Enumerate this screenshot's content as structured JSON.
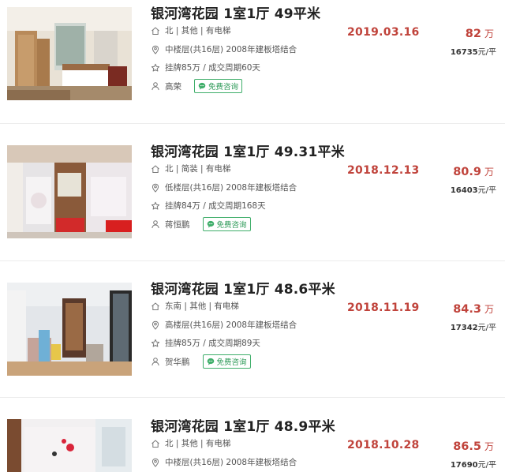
{
  "listings": [
    {
      "title": "银河湾花园 1室1厅 49平米",
      "orientation": "北 | 其他 | 有电梯",
      "floor": "中楼层(共16层) 2008年建板塔结合",
      "listing": "挂牌85万 / 成交周期60天",
      "agent": "高荣",
      "consult": "免费咨询",
      "date": "2019.03.16",
      "price": "82",
      "price_unit": "万",
      "unit_price": "16735",
      "unit_price_suffix": "元/平"
    },
    {
      "title": "银河湾花园 1室1厅 49.31平米",
      "orientation": "北 | 简装 | 有电梯",
      "floor": "低楼层(共16层) 2008年建板塔结合",
      "listing": "挂牌84万 / 成交周期168天",
      "agent": "蒋恒鹏",
      "consult": "免费咨询",
      "date": "2018.12.13",
      "price": "80.9",
      "price_unit": "万",
      "unit_price": "16403",
      "unit_price_suffix": "元/平"
    },
    {
      "title": "银河湾花园 1室1厅 48.6平米",
      "orientation": "东南 | 其他 | 有电梯",
      "floor": "高楼层(共16层) 2008年建板塔结合",
      "listing": "挂牌85万 / 成交周期89天",
      "agent": "贺华鹏",
      "consult": "免费咨询",
      "date": "2018.11.19",
      "price": "84.3",
      "price_unit": "万",
      "unit_price": "17342",
      "unit_price_suffix": "元/平"
    },
    {
      "title": "银河湾花园 1室1厅 48.9平米",
      "orientation": "北 | 其他 | 有电梯",
      "floor": "中楼层(共16层) 2008年建板塔结合",
      "listing": "",
      "agent": "",
      "consult": "",
      "date": "2018.10.28",
      "price": "86.5",
      "price_unit": "万",
      "unit_price": "17690",
      "unit_price_suffix": "元/平"
    }
  ],
  "colors": {
    "accent_red": "#c0433b",
    "consult_green": "#3fae6a"
  }
}
